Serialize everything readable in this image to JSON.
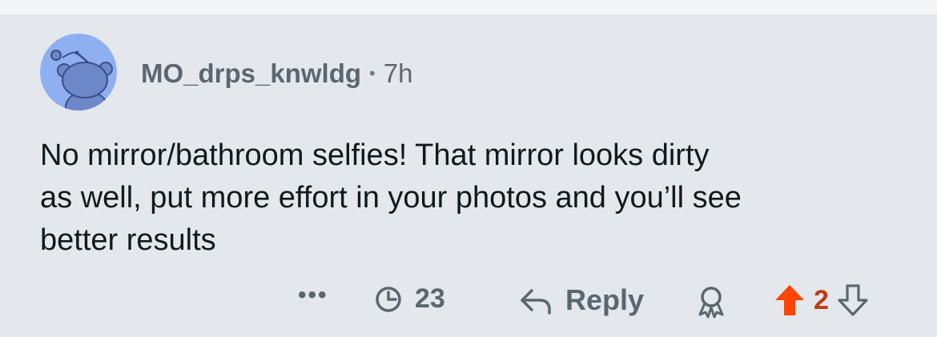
{
  "comment": {
    "username": "MO_drps_knwldg",
    "separator": "•",
    "time": "7h",
    "text": "No mirror/bathroom selfies! That mirror looks dirty\nas well, put more effort in your photos and you’ll see\nbetter results"
  },
  "actions": {
    "more_label": "•••",
    "views_count": "23",
    "reply_label": "Reply",
    "vote_count": "2"
  },
  "colors": {
    "card_bg": "#e4e8ec",
    "avatar_bg": "#8fb0f0",
    "upvote_active": "#ff4500",
    "vote_count": "#bf3b13"
  },
  "icons": [
    "snoo-avatar-icon",
    "clock-icon",
    "reply-arrow-icon",
    "award-icon",
    "upvote-arrow-icon",
    "downvote-arrow-icon"
  ]
}
